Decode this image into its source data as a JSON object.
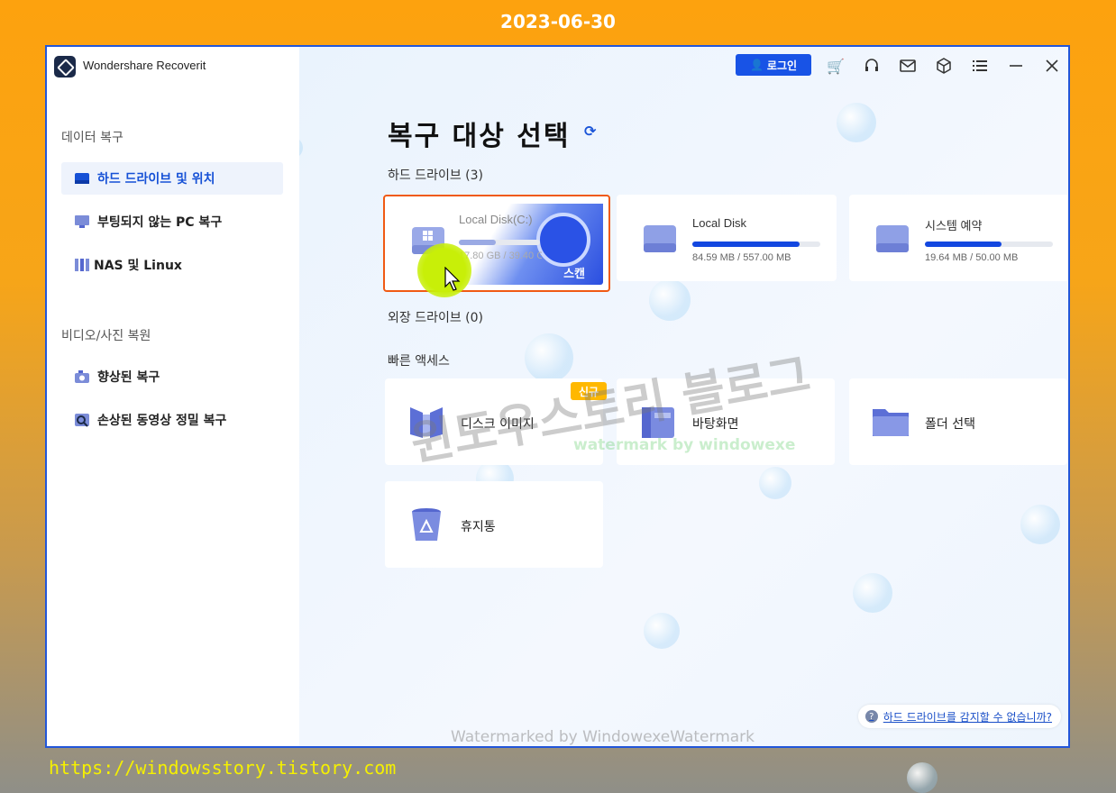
{
  "overlay": {
    "date": "2023-06-30",
    "url": "https://windowsstory.tistory.com",
    "watermark_large": "윈도우스토리 블로그",
    "watermark_green": "watermark by windowexe",
    "watermark_bottom": "Watermarked by WindowexeWatermark"
  },
  "titlebar": {
    "app_title": "Wondershare Recoverit",
    "login_label": "로그인",
    "icons": [
      "user-icon",
      "cart-icon",
      "headset-icon",
      "mail-icon",
      "box-icon",
      "menu-icon",
      "minimize-icon",
      "close-icon"
    ]
  },
  "sidebar": {
    "section1": "데이터 복구",
    "items1": [
      {
        "label": "하드 드라이브 및 위치",
        "icon": "drive-icon",
        "active": true
      },
      {
        "label": "부팅되지 않는 PC 복구",
        "icon": "monitor-icon",
        "active": false
      },
      {
        "label": "NAS 및 Linux",
        "icon": "nas-icon",
        "active": false
      }
    ],
    "section2": "비디오/사진 복원",
    "items2": [
      {
        "label": "향상된 복구",
        "icon": "camera-icon"
      },
      {
        "label": "손상된 동영상 정밀 복구",
        "icon": "video-repair-icon"
      }
    ]
  },
  "main": {
    "title": "복구 대상 선택",
    "hard_drives_label": "하드 드라이브 (3)",
    "drives": [
      {
        "name": "Local Disk(C:)",
        "size": "17.80 GB / 39.40 GB",
        "usage": 0.45,
        "scan_label": "스캔"
      },
      {
        "name": "Local Disk",
        "size": "84.59 MB / 557.00 MB",
        "usage": 0.84
      },
      {
        "name": "시스템 예약",
        "size": "19.64 MB / 50.00 MB",
        "usage": 0.6
      }
    ],
    "external_label": "외장 드라이브 (0)",
    "quick_access_label": "빠른 액세스",
    "quick_access": [
      {
        "name": "디스크 이미지",
        "badge": "신규",
        "icon": "disk-image-icon"
      },
      {
        "name": "바탕화면",
        "icon": "desktop-icon"
      },
      {
        "name": "폴더 선택",
        "icon": "folder-icon"
      },
      {
        "name": "휴지통",
        "icon": "recycle-bin-icon"
      }
    ],
    "help_link": "하드 드라이브를 감지할 수 없습니까?"
  },
  "colors": {
    "accent": "#1853e6",
    "selected_border": "#f05a14",
    "badge": "#ffb800",
    "background": "#fda20e"
  }
}
